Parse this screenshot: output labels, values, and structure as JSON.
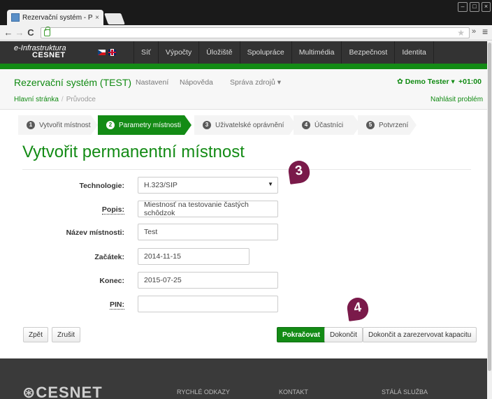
{
  "browser": {
    "tab_title": "Rezervační systém - Prův",
    "tab_close": "×",
    "back": "←",
    "forward": "→",
    "reload": "C",
    "window_controls": [
      "–",
      "□",
      "×"
    ],
    "ext_label": "»",
    "menu_label": "≡",
    "star": "★"
  },
  "sitebar": {
    "logo_line1": "e-Infrastruktura",
    "logo_line2": "CESNET",
    "nav": [
      "Síť",
      "Výpočty",
      "Úložiště",
      "Spolupráce",
      "Multimédia",
      "Bezpečnost",
      "Identita"
    ]
  },
  "app": {
    "title": "Rezervační systém (TEST)",
    "nav": [
      "Nastavení",
      "Nápověda",
      "Správa zdrojů ▾"
    ],
    "user": "✿ Demo Tester ▾",
    "timezone": "+01:00",
    "breadcrumb_home": "Hlavní stránka",
    "breadcrumb_sep": "/",
    "breadcrumb_current": "Průvodce",
    "report": "Nahlásit problém"
  },
  "wizard": {
    "steps": [
      {
        "num": "1",
        "label": "Vytvořit místnost"
      },
      {
        "num": "2",
        "label": "Parametry místnosti"
      },
      {
        "num": "3",
        "label": "Uživatelské oprávnění"
      },
      {
        "num": "4",
        "label": "Účastníci"
      },
      {
        "num": "5",
        "label": "Potvrzení"
      }
    ],
    "active_step": 2
  },
  "page_title": "Vytvořit permanentní místnost",
  "form": {
    "technology_label": "Technologie:",
    "technology_value": "H.323/SIP",
    "technology_caret": "▼",
    "description_label": "Popis:",
    "description_value": "Miestnosť na testovanie častých schôdzok",
    "room_name_label": "Název místnosti:",
    "room_name_value": "Test",
    "start_label": "Začátek:",
    "start_value": "2014-11-15",
    "end_label": "Konec:",
    "end_value": "2015-07-25",
    "pin_label": "PIN:",
    "pin_value": ""
  },
  "badges": [
    "3",
    "4"
  ],
  "buttons": {
    "back": "Zpět",
    "cancel": "Zrušit",
    "continue": "Pokračovat",
    "finish": "Dokončit",
    "finish_reserve": "Dokončit a zarezervovat kapacitu"
  },
  "footer": {
    "logo": "⊛CESNET",
    "quick_links": "RYCHLÉ ODKAZY",
    "contact": "KONTAKT",
    "service": "STÁLÁ SLUŽBA"
  },
  "colors": {
    "brand_green": "#138b15",
    "badge_purple": "#7a1a4a",
    "dark_bar": "#333333"
  }
}
